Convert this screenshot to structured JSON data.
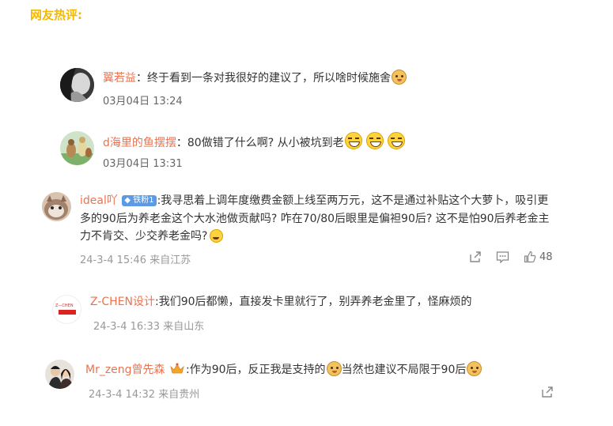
{
  "header": {
    "title": "网友热评:"
  },
  "comments": [
    {
      "user": "翼若益",
      "sep": "：",
      "text": "终于看到一条对我很好的建议了，所以啥时候施舍",
      "time": "03月04日 13:24",
      "emojis": [
        "doge-icon"
      ]
    },
    {
      "user": "d海里的鱼摆摆",
      "sep": "：",
      "text": "80做错了什么啊? 从小被坑到老",
      "time": "03月04日 13:31",
      "emojis": [
        "laugh-icon",
        "laugh-icon",
        "laugh-icon"
      ]
    },
    {
      "user": "ideal吖",
      "badge": "铁粉1",
      "lines": [
        ":我寻思着上调年度缴费金额上线至两万元，这不是通过补贴这个大萝卜，吸引更",
        "多的90后为养老金这个大水池做贡献吗? 咋在70/80后眼里是偏袒90后? 这不是怕90后养老金主",
        "力不肯交、少交养老金吗?"
      ],
      "time": "24-3-4 15:46 来自江苏",
      "likes": "48"
    },
    {
      "user": "Z-CHEN设计",
      "text": ":我们90后都懒，直接发卡里就行了，别弄养老金里了，怪麻烦的",
      "time": "24-3-4 16:33 来自山东",
      "avatar_text": "Z—CHEN"
    },
    {
      "user": "Mr_zeng曾先森",
      "text_a": ":作为90后，反正我是支持的",
      "text_b": "当然也建议不局限于90后",
      "time": "24-3-4 14:32 来自贵州"
    }
  ],
  "colors": {
    "username": "#eb7350",
    "header": "#f5b800",
    "badge": "#5d9ae6"
  }
}
